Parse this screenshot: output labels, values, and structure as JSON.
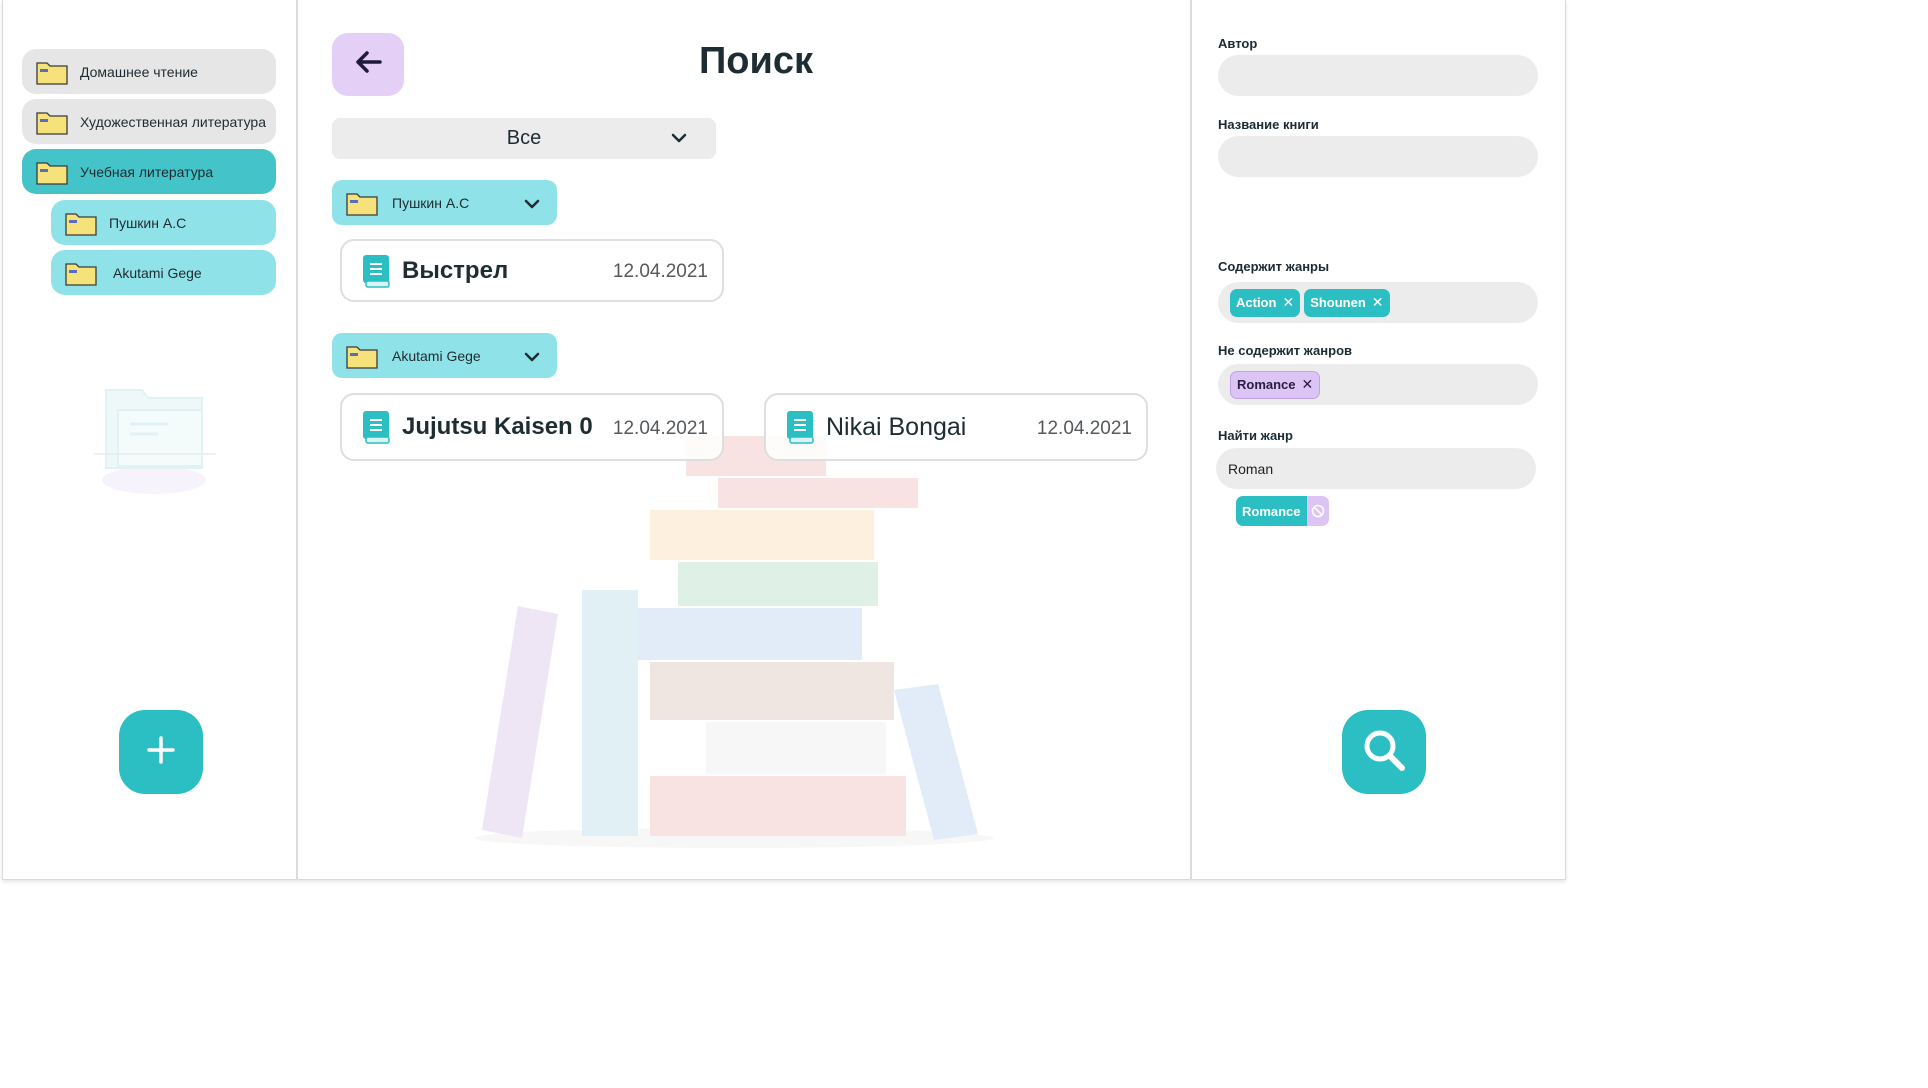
{
  "sidebar": {
    "folders": [
      {
        "label": "Домашнее чтение"
      },
      {
        "label": "Художественная литература"
      },
      {
        "label": "Учебная литература"
      },
      {
        "label": "Пушкин А.С"
      },
      {
        "label": "Akutami Gege"
      }
    ],
    "add_icon": "plus-icon"
  },
  "main": {
    "title": "Поиск",
    "back_icon": "arrow-left-icon",
    "filter_select": {
      "value": "Все"
    },
    "groups": [
      {
        "name": "Пушкин А.С",
        "books": [
          {
            "title": "Выстрел",
            "date": "12.04.2021"
          }
        ]
      },
      {
        "name": "Akutami Gege",
        "books": [
          {
            "title": "Jujutsu Kaisen 0",
            "date": "12.04.2021"
          },
          {
            "title": "Nikai Bongai",
            "date": "12.04.2021"
          }
        ]
      }
    ]
  },
  "filters": {
    "author_label": "Автор",
    "author_value": "",
    "book_title_label": "Название книги",
    "book_title_value": "",
    "include_genres_label": "Содержит жанры",
    "include_genres": [
      "Action",
      "Shounen"
    ],
    "exclude_genres_label": "Не содержит жанров",
    "exclude_genres": [
      "Romance"
    ],
    "find_genre_label": "Найти жанр",
    "find_genre_value": "Roman",
    "suggestions": [
      "Romance"
    ],
    "search_icon": "search-icon"
  },
  "colors": {
    "accent": "#2bbfc3",
    "accent_light": "#8fe3e8",
    "purple": "#e4cff7",
    "field_bg": "#ececec"
  }
}
